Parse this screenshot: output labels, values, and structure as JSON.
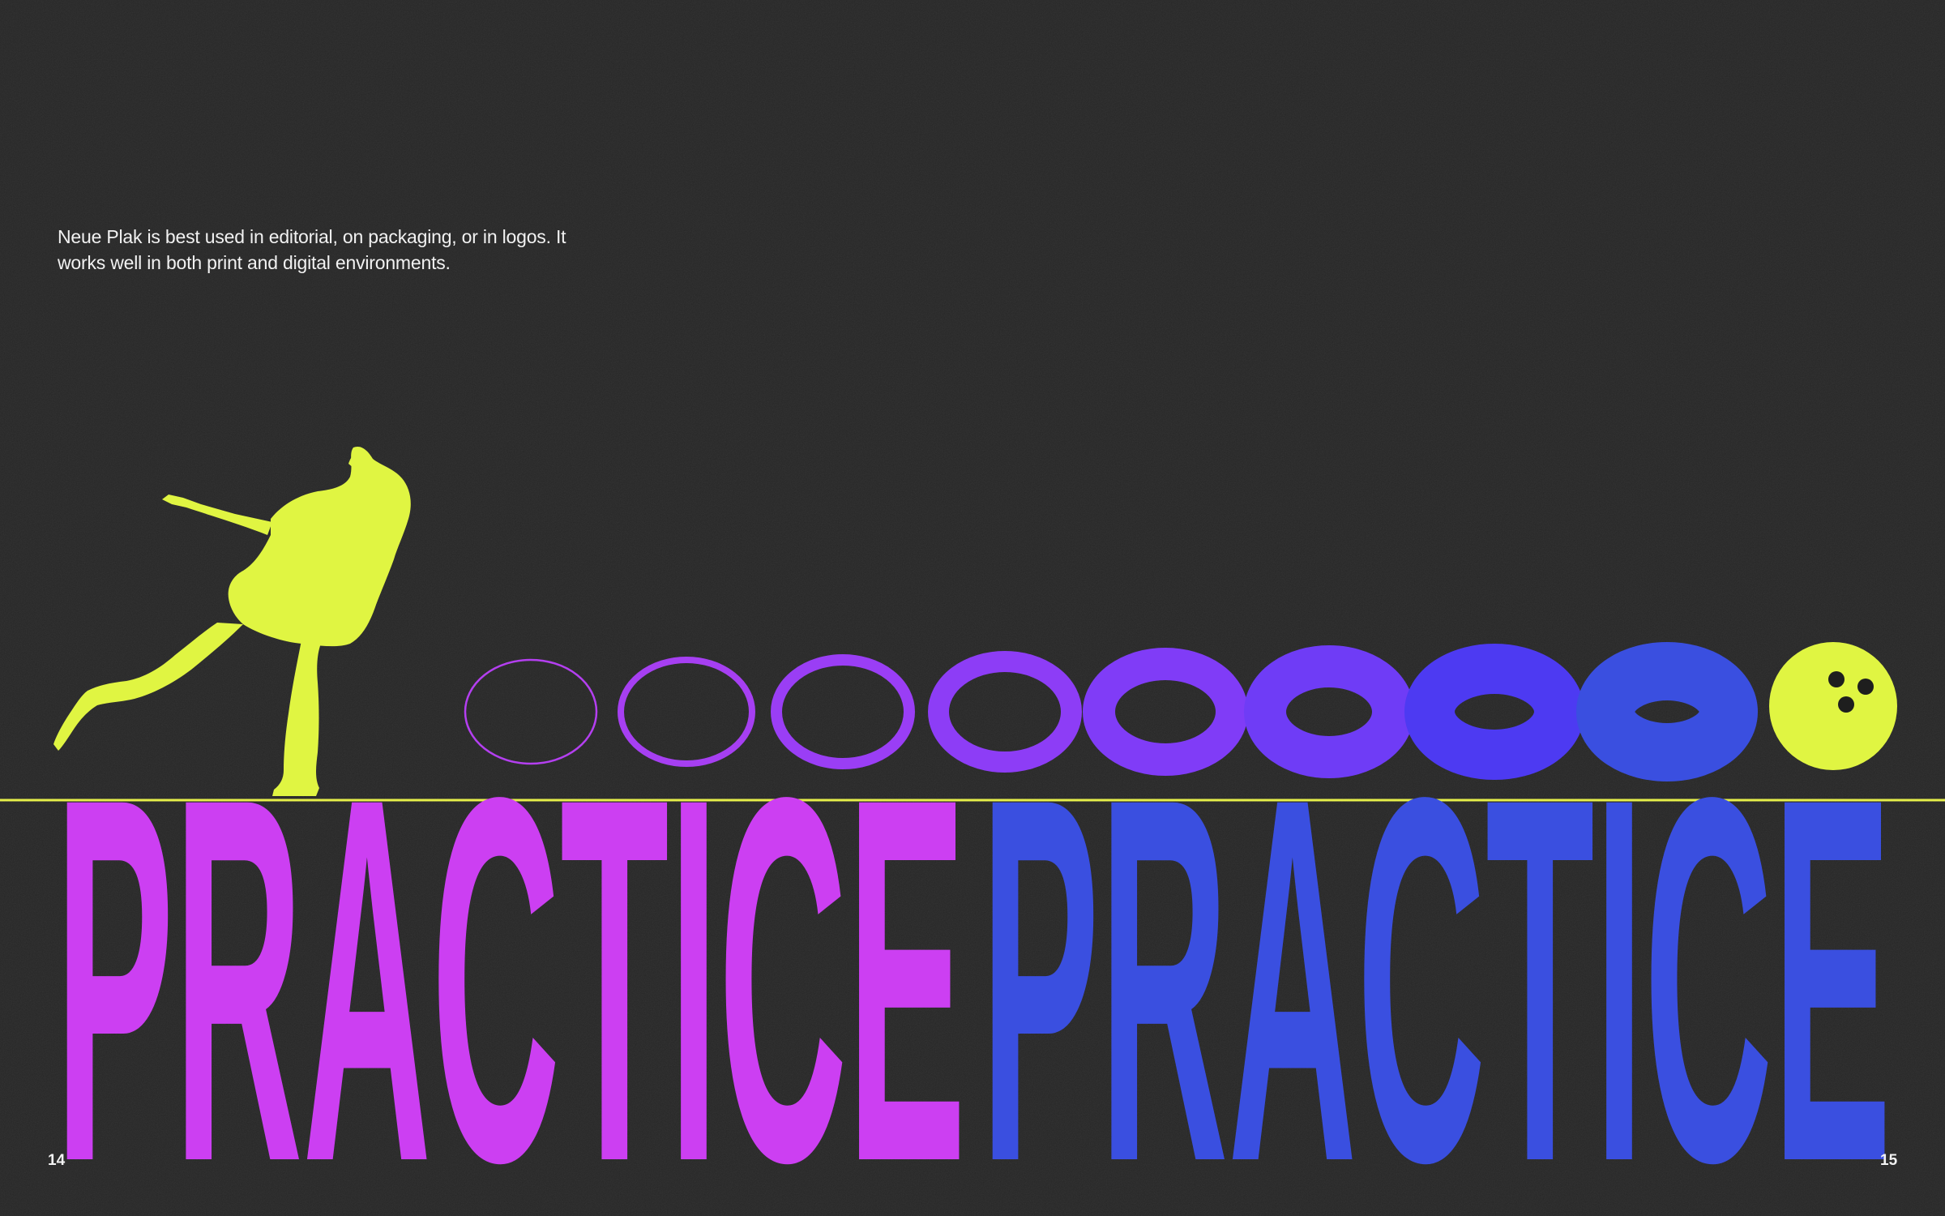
{
  "intro_text": "Neue Plak is best used in editorial, on packaging, or in logos. It works well in both print and digital environments.",
  "headline_left": "PRACTICE",
  "headline_right": "PRACTICE",
  "page_left": "14",
  "page_right": "15",
  "colors": {
    "background": "#262626",
    "magenta": "#cc3ff2",
    "blue": "#3a4fe0",
    "lime": "#e0f542",
    "rule": "#e6ef4a"
  },
  "icons": {
    "figure": "bowler-silhouette",
    "ball": "bowling-ball-icon"
  },
  "weight_ovals": [
    {
      "color": "#b43ff0"
    },
    {
      "color": "#a63ff2"
    },
    {
      "color": "#9a3ef5"
    },
    {
      "color": "#8d3df6"
    },
    {
      "color": "#803cf7"
    },
    {
      "color": "#6f3cf6"
    },
    {
      "color": "#4d3af2"
    },
    {
      "color": "#3a4fe0"
    }
  ]
}
